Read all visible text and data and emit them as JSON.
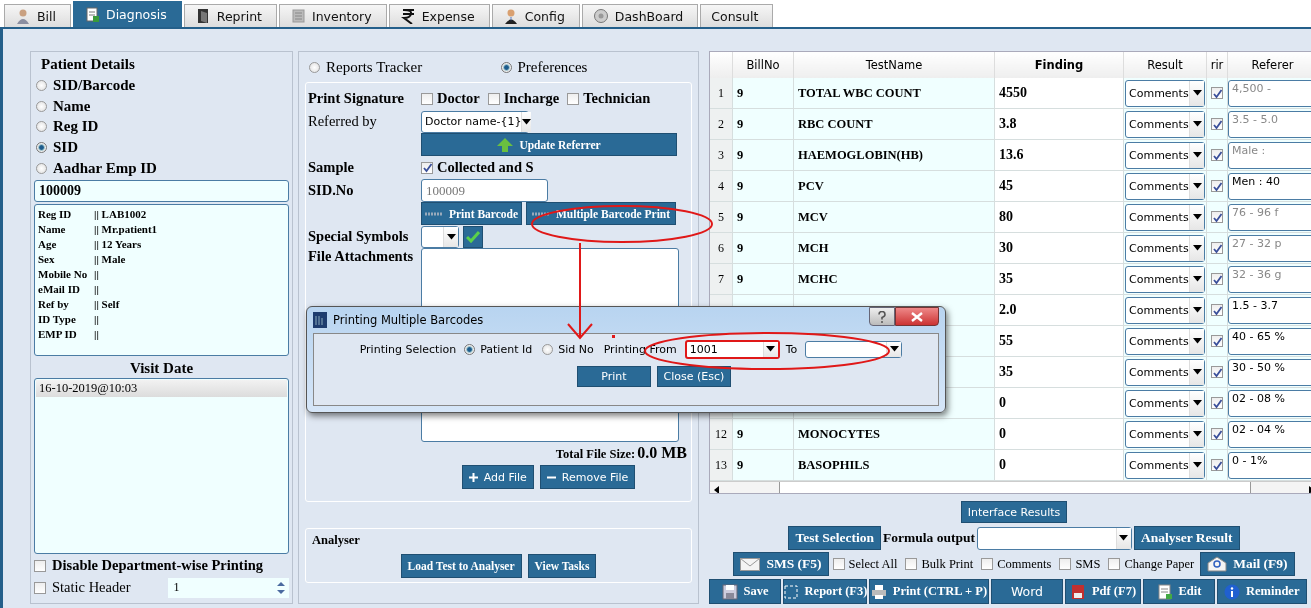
{
  "tabs": [
    {
      "label": "Bill",
      "selected": false
    },
    {
      "label": "Diagnosis",
      "selected": true
    },
    {
      "label": "Reprint",
      "selected": false
    },
    {
      "label": "Inventory",
      "selected": false
    },
    {
      "label": "Expense",
      "selected": false
    },
    {
      "label": "Config",
      "selected": false
    },
    {
      "label": "DashBoard",
      "selected": false
    },
    {
      "label": "Consult",
      "selected": false
    }
  ],
  "patient_details": {
    "title": "Patient Details",
    "search_by": [
      {
        "label": "SID/Barcode",
        "selected": false
      },
      {
        "label": "Name",
        "selected": false
      },
      {
        "label": "Reg ID",
        "selected": false
      },
      {
        "label": "SID",
        "selected": true
      },
      {
        "label": "Aadhar Emp ID",
        "selected": false
      }
    ],
    "search_value": "100009",
    "info": [
      {
        "label": "Reg ID",
        "value": "|| LAB1002"
      },
      {
        "label": "Name",
        "value": "|| Mr.patient1"
      },
      {
        "label": "Age",
        "value": "|| 12 Years"
      },
      {
        "label": "Sex",
        "value": "|| Male"
      },
      {
        "label": "Mobile No",
        "value": "||"
      },
      {
        "label": "eMail ID",
        "value": "||"
      },
      {
        "label": "Ref by",
        "value": "|| Self"
      },
      {
        "label": "ID Type",
        "value": "||"
      },
      {
        "label": "EMP ID",
        "value": "||"
      }
    ],
    "visit_date_title": "Visit Date",
    "visit_dates": [
      {
        "text": "16-10-2019@10:03",
        "selected": true
      }
    ],
    "disable_department_printing": {
      "label": "Disable Department-wise Printing",
      "checked": false
    },
    "static_header": {
      "label": "Static Header",
      "checked": false,
      "value": "1"
    }
  },
  "preferences": {
    "modes": [
      {
        "label": "Reports Tracker",
        "selected": false
      },
      {
        "label": "Preferences",
        "selected": true
      }
    ],
    "print_signature": {
      "label": "Print Signature",
      "options": [
        {
          "label": "Doctor",
          "checked": false
        },
        {
          "label": "Incharge",
          "checked": false
        },
        {
          "label": "Technician",
          "checked": false
        }
      ]
    },
    "referred_by": {
      "label": "Referred by",
      "value": "Doctor name-{1}"
    },
    "update_referrer": "Update Referrer",
    "sample": {
      "label": "Sample",
      "option": "Collected and S",
      "checked": true
    },
    "sid_no": {
      "label": "SID.No",
      "value": "100009"
    },
    "print_barcode": "Print Barcode",
    "multiple_barcode_print": "Multiple Barcode Print",
    "special_symbols": "Special Symbols",
    "file_attachments": "File Attachments",
    "total_file_size_label": "Total File Size:",
    "total_file_size": "0.0 MB",
    "add_file": "Add File",
    "remove_file": "Remove File",
    "analyser": {
      "title": "Analyser",
      "buttons": [
        "Load Test to Analyser",
        "View Tasks"
      ]
    }
  },
  "results": {
    "columns": [
      {
        "label": "BillNo",
        "bold": false
      },
      {
        "label": "TestName",
        "bold": false
      },
      {
        "label": "Finding",
        "bold": true
      },
      {
        "label": "Result",
        "bold": false
      },
      {
        "label": "rir",
        "bold": false
      },
      {
        "label": "Referer",
        "bold": false
      }
    ],
    "rows": [
      {
        "number": "1",
        "bill_no": "9",
        "test": "TOTAL WBC COUNT",
        "finding": "4550",
        "result": "Comments",
        "checked": true,
        "reference": "4,500 -",
        "dimmed": true
      },
      {
        "number": "2",
        "bill_no": "9",
        "test": "RBC COUNT",
        "finding": "3.8",
        "result": "Comments",
        "checked": true,
        "reference": "3.5 - 5.0",
        "dimmed": true
      },
      {
        "number": "3",
        "bill_no": "9",
        "test": "HAEMOGLOBIN(HB)",
        "finding": "13.6",
        "result": "Comments",
        "checked": true,
        "reference": "Male :",
        "dimmed": true
      },
      {
        "number": "4",
        "bill_no": "9",
        "test": "PCV",
        "finding": "45",
        "result": "Comments",
        "checked": true,
        "reference": "Men : 40",
        "dimmed": false
      },
      {
        "number": "5",
        "bill_no": "9",
        "test": "MCV",
        "finding": "80",
        "result": "Comments",
        "checked": true,
        "reference": "76 - 96 f",
        "dimmed": true
      },
      {
        "number": "6",
        "bill_no": "9",
        "test": "MCH",
        "finding": "30",
        "result": "Comments",
        "checked": true,
        "reference": "27 - 32 p",
        "dimmed": true
      },
      {
        "number": "7",
        "bill_no": "9",
        "test": "MCHC",
        "finding": "35",
        "result": "Comments",
        "checked": true,
        "reference": "32 - 36 g",
        "dimmed": true
      },
      {
        "finding": "2.0",
        "result": "Comments",
        "checked": true,
        "reference": "1.5 - 3.7",
        "dimmed": false
      },
      {
        "finding": "55",
        "result": "Comments",
        "checked": true,
        "reference": "40 - 65 %",
        "dimmed": false
      },
      {
        "finding": "35",
        "result": "Comments",
        "checked": true,
        "reference": "30 - 50 %",
        "dimmed": false
      },
      {
        "finding": "0",
        "result": "Comments",
        "checked": true,
        "reference": "02 - 08 %",
        "dimmed": false
      },
      {
        "number": "12",
        "bill_no": "9",
        "test": "MONOCYTES",
        "finding": "0",
        "result": "Comments",
        "checked": true,
        "reference": "02 - 04 %",
        "dimmed": false
      },
      {
        "number": "13",
        "bill_no": "9",
        "test": "BASOPHILS",
        "finding": "0",
        "result": "Comments",
        "checked": true,
        "reference": "0 - 1%",
        "dimmed": false
      }
    ],
    "interface_results": "Interface Results",
    "test_selection": "Test Selection",
    "formula_output": "Formula output",
    "analyser_result": "Analyser Result",
    "sms_button": "SMS (F5)",
    "options": [
      {
        "label": "Select All",
        "checked": false
      },
      {
        "label": "Bulk Print",
        "checked": false
      },
      {
        "label": "Comments",
        "checked": false
      },
      {
        "label": "SMS",
        "checked": false
      },
      {
        "label": "Change Paper",
        "checked": false
      }
    ],
    "mail_button": "Mail (F9)",
    "actions": [
      "Save",
      "Report (F3)",
      "Print (CTRL + P)",
      "Word",
      "Pdf (F7)",
      "Edit",
      "Reminder"
    ]
  },
  "dialog": {
    "title": "Printing Multiple Barcodes",
    "selection_label": "Printing Selection",
    "selection": [
      {
        "label": "Patient Id",
        "selected": true
      },
      {
        "label": "Sid No",
        "selected": false
      }
    ],
    "from_label": "Printing From",
    "from_value": "1001",
    "to_label": "To",
    "buttons": [
      "Print",
      "Close (Esc)"
    ]
  }
}
